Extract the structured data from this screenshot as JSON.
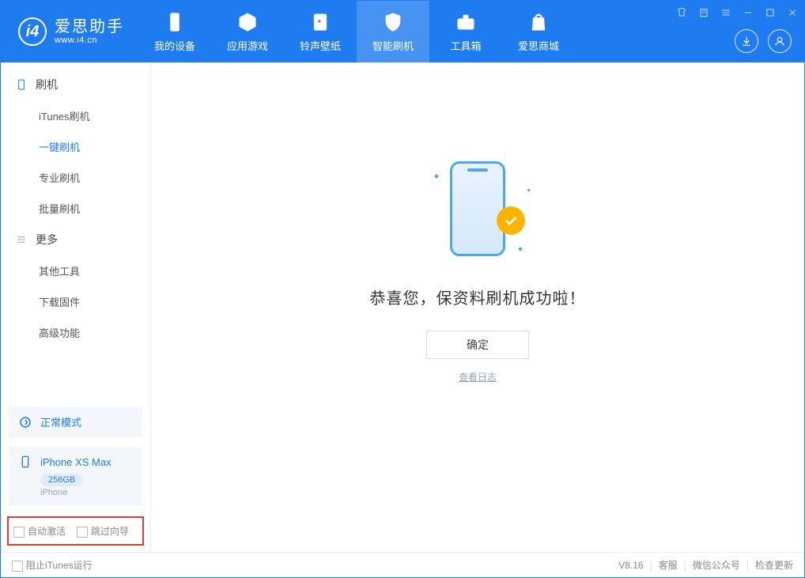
{
  "app": {
    "name_cn": "爱思助手",
    "url": "www.i4.cn"
  },
  "nav": {
    "device": "我的设备",
    "apps": "应用游戏",
    "ringtone": "铃声壁纸",
    "flash": "智能刷机",
    "toolbox": "工具箱",
    "store": "爱思商城"
  },
  "sidebar": {
    "flash_section": "刷机",
    "items": {
      "itunes": "iTunes刷机",
      "oneclick": "一键刷机",
      "pro": "专业刷机",
      "batch": "批量刷机"
    },
    "more_section": "更多",
    "more_items": {
      "other": "其他工具",
      "download": "下载固件",
      "advanced": "高级功能"
    }
  },
  "status": {
    "mode": "正常模式"
  },
  "device": {
    "name": "iPhone XS Max",
    "storage": "256GB",
    "type": "iPhone"
  },
  "options": {
    "auto_activate": "自动激活",
    "skip_guide": "跳过向导"
  },
  "main": {
    "success_msg": "恭喜您，保资料刷机成功啦！",
    "ok_btn": "确定",
    "log_link": "查看日志"
  },
  "statusbar": {
    "block_itunes": "阻止iTunes运行",
    "version": "V8.16",
    "support": "客服",
    "wechat": "微信公众号",
    "update": "检查更新"
  }
}
